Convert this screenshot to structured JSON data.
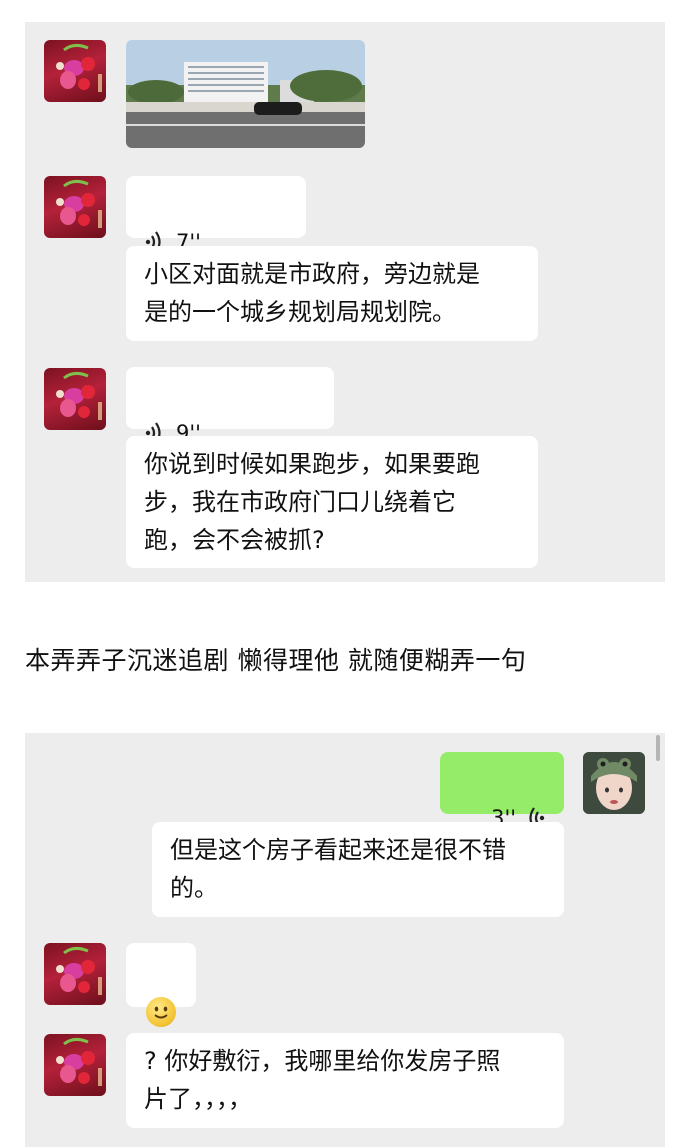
{
  "chat_top": {
    "messages": [
      {
        "type": "image",
        "alt": ""
      },
      {
        "type": "voice",
        "duration": "7''"
      },
      {
        "type": "text",
        "text": "小区对面就是市政府，旁边就是\n是的一个城乡规划局规划院。"
      },
      {
        "type": "voice",
        "duration": "9''"
      },
      {
        "type": "text",
        "text": "你说到时候如果跑步，如果要跑\n步，我在市政府门口儿绕着它\n跑，会不会被抓?"
      }
    ]
  },
  "caption": "本弄弄子沉迷追剧 懒得理他 就随便糊弄一句",
  "chat_bottom": {
    "messages": [
      {
        "type": "voice",
        "duration": "3''",
        "sender": "self"
      },
      {
        "type": "text",
        "text": "但是这个房子看起来还是很不错\n的。",
        "sender": "self"
      },
      {
        "type": "emoji",
        "name": "smile-emoji"
      },
      {
        "type": "text",
        "text": "? 你好敷衍，我哪里给你发房子照\n片了，，，，"
      }
    ]
  },
  "colors": {
    "chat_background": "#ededed",
    "bubble_other": "#ffffff",
    "bubble_self": "#95ec69"
  },
  "icons": [
    "voice-wave-icon",
    "smile-emoji"
  ]
}
